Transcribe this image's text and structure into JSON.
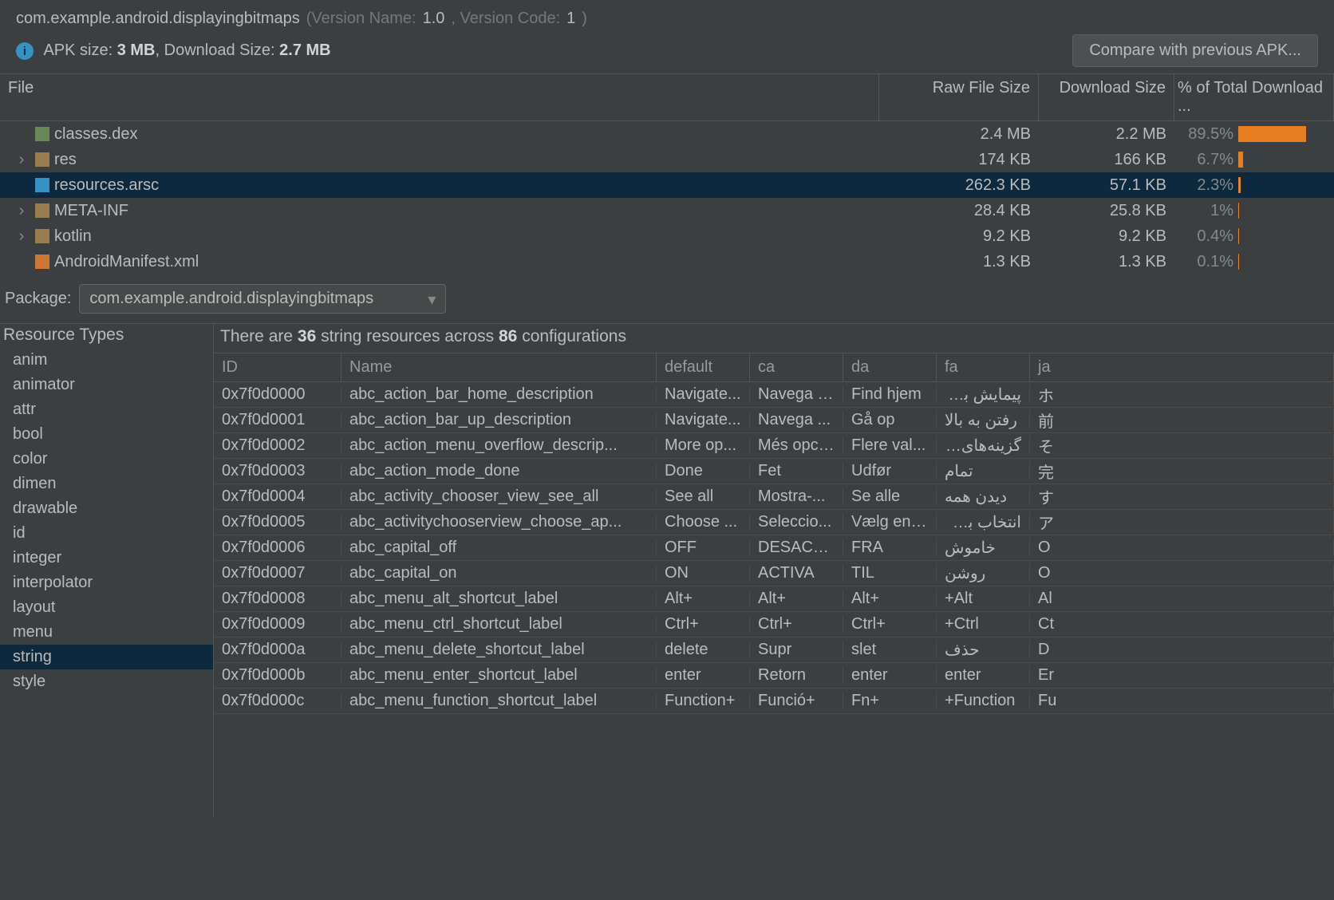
{
  "header": {
    "package_name": "com.example.android.displayingbitmaps",
    "version_name_label": "(Version Name: ",
    "version_name": "1.0",
    "version_code_label": ", Version Code: ",
    "version_code": "1",
    "close_paren": ")",
    "apk_size_label": "APK size: ",
    "apk_size": "3 MB",
    "download_size_label": ", Download Size: ",
    "download_size": "2.7 MB",
    "compare_button": "Compare with previous APK..."
  },
  "file_table": {
    "headers": {
      "file": "File",
      "raw": "Raw File Size",
      "download": "Download Size",
      "pct": "% of Total Download ..."
    },
    "rows": [
      {
        "name": "classes.dex",
        "icon": "dex",
        "raw": "2.4 MB",
        "dl": "2.2 MB",
        "pct": "89.5%",
        "pct_w": 100,
        "expand": false,
        "selected": false
      },
      {
        "name": "res",
        "icon": "folder",
        "raw": "174 KB",
        "dl": "166 KB",
        "pct": "6.7%",
        "pct_w": 7,
        "expand": true,
        "selected": false
      },
      {
        "name": "resources.arsc",
        "icon": "arsc",
        "raw": "262.3 KB",
        "dl": "57.1 KB",
        "pct": "2.3%",
        "pct_w": 3,
        "expand": false,
        "selected": true
      },
      {
        "name": "META-INF",
        "icon": "folder",
        "raw": "28.4 KB",
        "dl": "25.8 KB",
        "pct": "1%",
        "pct_w": 1,
        "expand": true,
        "selected": false
      },
      {
        "name": "kotlin",
        "icon": "folder",
        "raw": "9.2 KB",
        "dl": "9.2 KB",
        "pct": "0.4%",
        "pct_w": 1,
        "expand": true,
        "selected": false
      },
      {
        "name": "AndroidManifest.xml",
        "icon": "xml",
        "raw": "1.3 KB",
        "dl": "1.3 KB",
        "pct": "0.1%",
        "pct_w": 1,
        "expand": false,
        "selected": false
      }
    ]
  },
  "package_selector": {
    "label": "Package:",
    "value": "com.example.android.displayingbitmaps"
  },
  "resource_types": {
    "header": "Resource Types",
    "items": [
      "anim",
      "animator",
      "attr",
      "bool",
      "color",
      "dimen",
      "drawable",
      "id",
      "integer",
      "interpolator",
      "layout",
      "menu",
      "string",
      "style"
    ],
    "selected": "string"
  },
  "resources": {
    "summary_prefix": "There are ",
    "count": "36",
    "summary_mid": " string resources across ",
    "configs": "86",
    "summary_suffix": " configurations",
    "headers": [
      "ID",
      "Name",
      "default",
      "ca",
      "da",
      "fa",
      "ja"
    ],
    "rows": [
      {
        "id": "0x7f0d0000",
        "name": "abc_action_bar_home_description",
        "default": "Navigate...",
        "ca": "Navega f...",
        "da": "Find hjem",
        "fa": "پیمایش به ...",
        "ja": "ホ"
      },
      {
        "id": "0x7f0d0001",
        "name": "abc_action_bar_up_description",
        "default": "Navigate...",
        "ca": "Navega ...",
        "da": "Gå op",
        "fa": "رفتن به بالا",
        "ja": "前"
      },
      {
        "id": "0x7f0d0002",
        "name": "abc_action_menu_overflow_descrip...",
        "default": "More op...",
        "ca": "Més opci...",
        "da": "Flere val...",
        "fa": "گزینه‌های بی...",
        "ja": "そ"
      },
      {
        "id": "0x7f0d0003",
        "name": "abc_action_mode_done",
        "default": "Done",
        "ca": "Fet",
        "da": "Udfør",
        "fa": "تمام",
        "ja": "完"
      },
      {
        "id": "0x7f0d0004",
        "name": "abc_activity_chooser_view_see_all",
        "default": "See all",
        "ca": "Mostra-...",
        "da": "Se alle",
        "fa": "دیدن همه",
        "ja": "す"
      },
      {
        "id": "0x7f0d0005",
        "name": "abc_activitychooserview_choose_ap...",
        "default": "Choose ...",
        "ca": "Seleccio...",
        "da": "Vælg en ...",
        "fa": "انتخاب برنامه",
        "ja": "ア"
      },
      {
        "id": "0x7f0d0006",
        "name": "abc_capital_off",
        "default": "OFF",
        "ca": "DESACTI...",
        "da": "FRA",
        "fa": "خاموش",
        "ja": "O"
      },
      {
        "id": "0x7f0d0007",
        "name": "abc_capital_on",
        "default": "ON",
        "ca": "ACTIVA",
        "da": "TIL",
        "fa": "روشن",
        "ja": "O"
      },
      {
        "id": "0x7f0d0008",
        "name": "abc_menu_alt_shortcut_label",
        "default": "Alt+",
        "ca": "Alt+",
        "da": "Alt+",
        "fa": "Alt+",
        "ja": "Al"
      },
      {
        "id": "0x7f0d0009",
        "name": "abc_menu_ctrl_shortcut_label",
        "default": "Ctrl+",
        "ca": "Ctrl+",
        "da": "Ctrl+",
        "fa": "Ctrl+",
        "ja": "Ct"
      },
      {
        "id": "0x7f0d000a",
        "name": "abc_menu_delete_shortcut_label",
        "default": "delete",
        "ca": "Supr",
        "da": "slet",
        "fa": "حذف",
        "ja": "D"
      },
      {
        "id": "0x7f0d000b",
        "name": "abc_menu_enter_shortcut_label",
        "default": "enter",
        "ca": "Retorn",
        "da": "enter",
        "fa": "enter",
        "ja": "Er"
      },
      {
        "id": "0x7f0d000c",
        "name": "abc_menu_function_shortcut_label",
        "default": "Function+",
        "ca": "Funció+",
        "da": "Fn+",
        "fa": "Function+",
        "ja": "Fu"
      }
    ]
  }
}
